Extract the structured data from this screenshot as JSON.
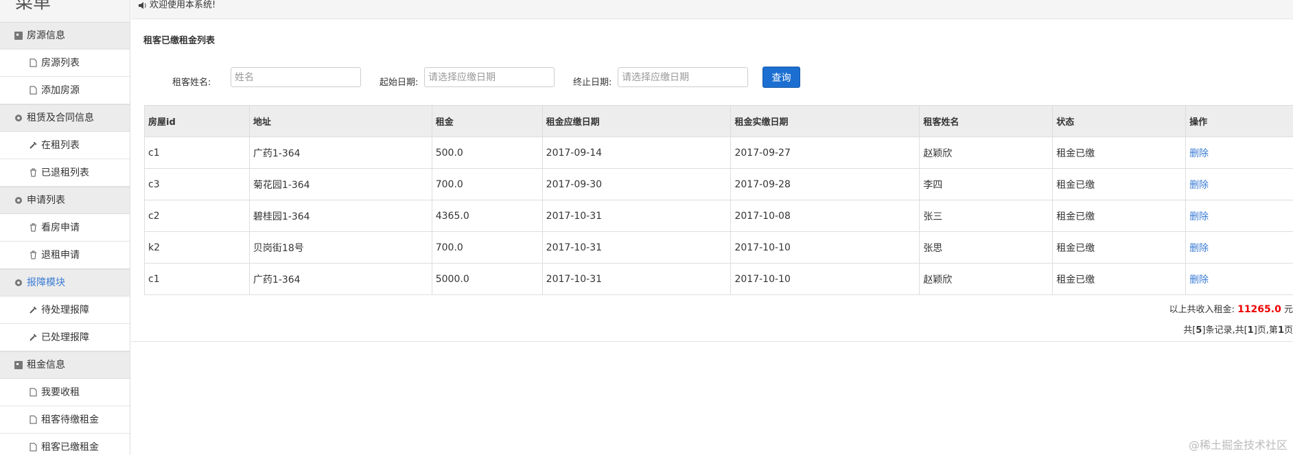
{
  "sidebar": {
    "title": "菜单",
    "groups": [
      {
        "label": "房源信息",
        "icon": "book-icon",
        "items": [
          {
            "label": "房源列表",
            "icon": "file-icon"
          },
          {
            "label": "添加房源",
            "icon": "file-icon"
          }
        ]
      },
      {
        "label": "租赁及合同信息",
        "icon": "gear-icon",
        "items": [
          {
            "label": "在租列表",
            "icon": "wrench-icon"
          },
          {
            "label": "已退租列表",
            "icon": "trash-icon"
          }
        ]
      },
      {
        "label": "申请列表",
        "icon": "gear-icon",
        "items": [
          {
            "label": "看房申请",
            "icon": "trash-icon"
          },
          {
            "label": "退租申请",
            "icon": "trash-icon"
          }
        ]
      },
      {
        "label": "报障模块",
        "icon": "gear-icon",
        "items": [
          {
            "label": "待处理报障",
            "icon": "wrench-icon"
          },
          {
            "label": "已处理报障",
            "icon": "wrench-icon"
          }
        ]
      },
      {
        "label": "租金信息",
        "icon": "book-icon",
        "items": [
          {
            "label": "我要收租",
            "icon": "file-icon"
          },
          {
            "label": "租客待缴租金",
            "icon": "file-icon"
          },
          {
            "label": "租客已缴租金",
            "icon": "file-icon"
          }
        ]
      }
    ]
  },
  "topbar": {
    "welcome": "欢迎使用本系统!",
    "icon": "speaker-icon"
  },
  "main": {
    "title": "租客已缴租金列表",
    "search": {
      "name_label": "租客姓名:",
      "name_placeholder": "姓名",
      "start_label": "起始日期:",
      "start_placeholder": "请选择应缴日期",
      "end_label": "终止日期:",
      "end_placeholder": "请选择应缴日期",
      "query_button": "查询"
    },
    "table": {
      "headers": [
        "房屋id",
        "地址",
        "租金",
        "租金应缴日期",
        "租金实缴日期",
        "租客姓名",
        "状态",
        "操作"
      ],
      "rows": [
        [
          "c1",
          "广药1-364",
          "500.0",
          "2017-09-14",
          "2017-09-27",
          "赵颖欣",
          "租金已缴",
          "删除"
        ],
        [
          "c3",
          "菊花园1-364",
          "700.0",
          "2017-09-30",
          "2017-09-28",
          "李四",
          "租金已缴",
          "删除"
        ],
        [
          "c2",
          "碧桂园1-364",
          "4365.0",
          "2017-10-31",
          "2017-10-08",
          "张三",
          "租金已缴",
          "删除"
        ],
        [
          "k2",
          "贝岗街18号",
          "700.0",
          "2017-10-31",
          "2017-10-10",
          "张思",
          "租金已缴",
          "删除"
        ],
        [
          "c1",
          "广药1-364",
          "5000.0",
          "2017-10-31",
          "2017-10-10",
          "赵颖欣",
          "租金已缴",
          "删除"
        ]
      ]
    },
    "summary": {
      "prefix": "以上共收入租金:",
      "amount": "11265.0",
      "unit": "元"
    },
    "pagination": {
      "p1": "共[",
      "records": "5",
      "p2": "]条记录,共[",
      "pages": "1",
      "p3": "]页,第",
      "current": "1",
      "p4": "页"
    }
  },
  "watermark": "@稀土掘金技术社区",
  "colors": {
    "accent": "#1c6fd1",
    "link": "#3a7bd5",
    "amount": "#ee0000"
  }
}
